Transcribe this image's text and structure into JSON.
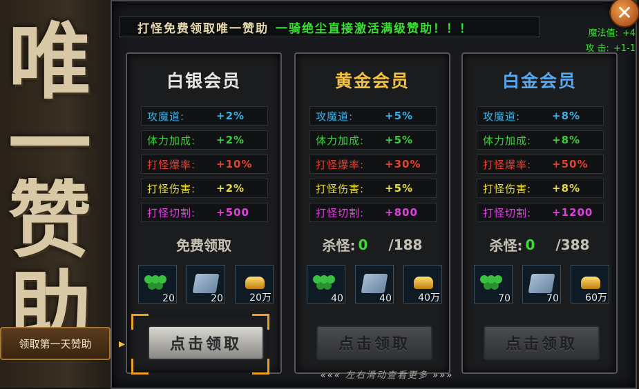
{
  "side": {
    "big_chars": [
      "唯",
      "一",
      "赞",
      "助"
    ],
    "tip_label": "领取第一天赞助",
    "tip_arrow": "▸"
  },
  "banner": {
    "part1": "打怪免费领取唯一赞助",
    "part2": "一骑绝尘直接激活满级赞助！！！"
  },
  "stats": [
    {
      "label": "魔法值:",
      "value": "+4"
    },
    {
      "label": "攻  击:",
      "value": "+1-1"
    }
  ],
  "close": {
    "glyph": "✕"
  },
  "cards": [
    {
      "title": "白银会员",
      "title_color": "#e8e6e0",
      "attrs": [
        {
          "label": "攻魔道:",
          "value": "+2%"
        },
        {
          "label": "体力加成:",
          "value": "+2%"
        },
        {
          "label": "打怪爆率:",
          "value": "+10%"
        },
        {
          "label": "打怪伤害:",
          "value": "+2%"
        },
        {
          "label": "打怪切割:",
          "value": "+500"
        }
      ],
      "requirement": {
        "text": "免费领取"
      },
      "items": [
        {
          "icon": "herb-icon",
          "count": "20"
        },
        {
          "icon": "cloth-icon",
          "count": "20"
        },
        {
          "icon": "gold-ingot-icon",
          "count": "20万"
        }
      ],
      "button": "点击领取"
    },
    {
      "title": "黄金会员",
      "title_color": "#f0c040",
      "attrs": [
        {
          "label": "攻魔道:",
          "value": "+5%"
        },
        {
          "label": "体力加成:",
          "value": "+5%"
        },
        {
          "label": "打怪爆率:",
          "value": "+30%"
        },
        {
          "label": "打怪伤害:",
          "value": "+5%"
        },
        {
          "label": "打怪切割:",
          "value": "+800"
        }
      ],
      "requirement": {
        "label": "杀怪:",
        "current": "0",
        "total": "/188"
      },
      "items": [
        {
          "icon": "herb-icon",
          "count": "40"
        },
        {
          "icon": "cloth-icon",
          "count": "40"
        },
        {
          "icon": "gold-ingot-icon",
          "count": "40万"
        }
      ],
      "button": "点击领取"
    },
    {
      "title": "白金会员",
      "title_color": "#58a8f0",
      "attrs": [
        {
          "label": "攻魔道:",
          "value": "+8%"
        },
        {
          "label": "体力加成:",
          "value": "+8%"
        },
        {
          "label": "打怪爆率:",
          "value": "+50%"
        },
        {
          "label": "打怪伤害:",
          "value": "+8%"
        },
        {
          "label": "打怪切割:",
          "value": "+1200"
        }
      ],
      "requirement": {
        "label": "杀怪:",
        "current": "0",
        "total": "/388"
      },
      "items": [
        {
          "icon": "herb-icon",
          "count": "70"
        },
        {
          "icon": "cloth-icon",
          "count": "70"
        },
        {
          "icon": "gold-ingot-icon",
          "count": "60万"
        }
      ],
      "button": "点击领取"
    }
  ],
  "footer_hint": {
    "left": "«««",
    "text": "左右滑动查看更多",
    "right": "»»»"
  }
}
